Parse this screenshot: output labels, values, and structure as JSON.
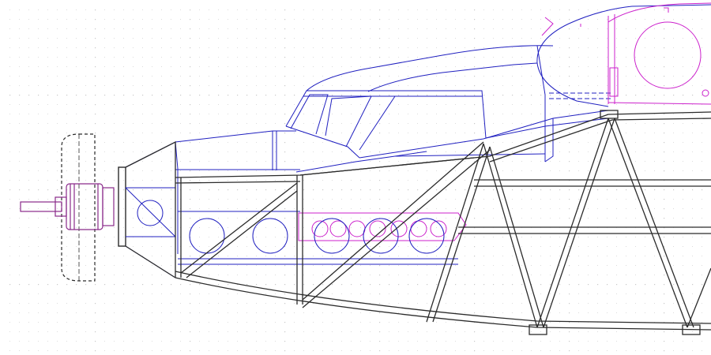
{
  "drawing": {
    "view": "fuselage-side-view",
    "show_grid": true
  },
  "colors": {
    "background": "#ffffff",
    "grid": "#c8c8c8",
    "structure": "#2b2b2b",
    "formers": "#2020c0",
    "ribs": "#cc22cc",
    "propeller_hub": "#8a2a8a"
  },
  "icons": {
    "propeller": "propeller-icon",
    "motor": "motor-icon"
  }
}
